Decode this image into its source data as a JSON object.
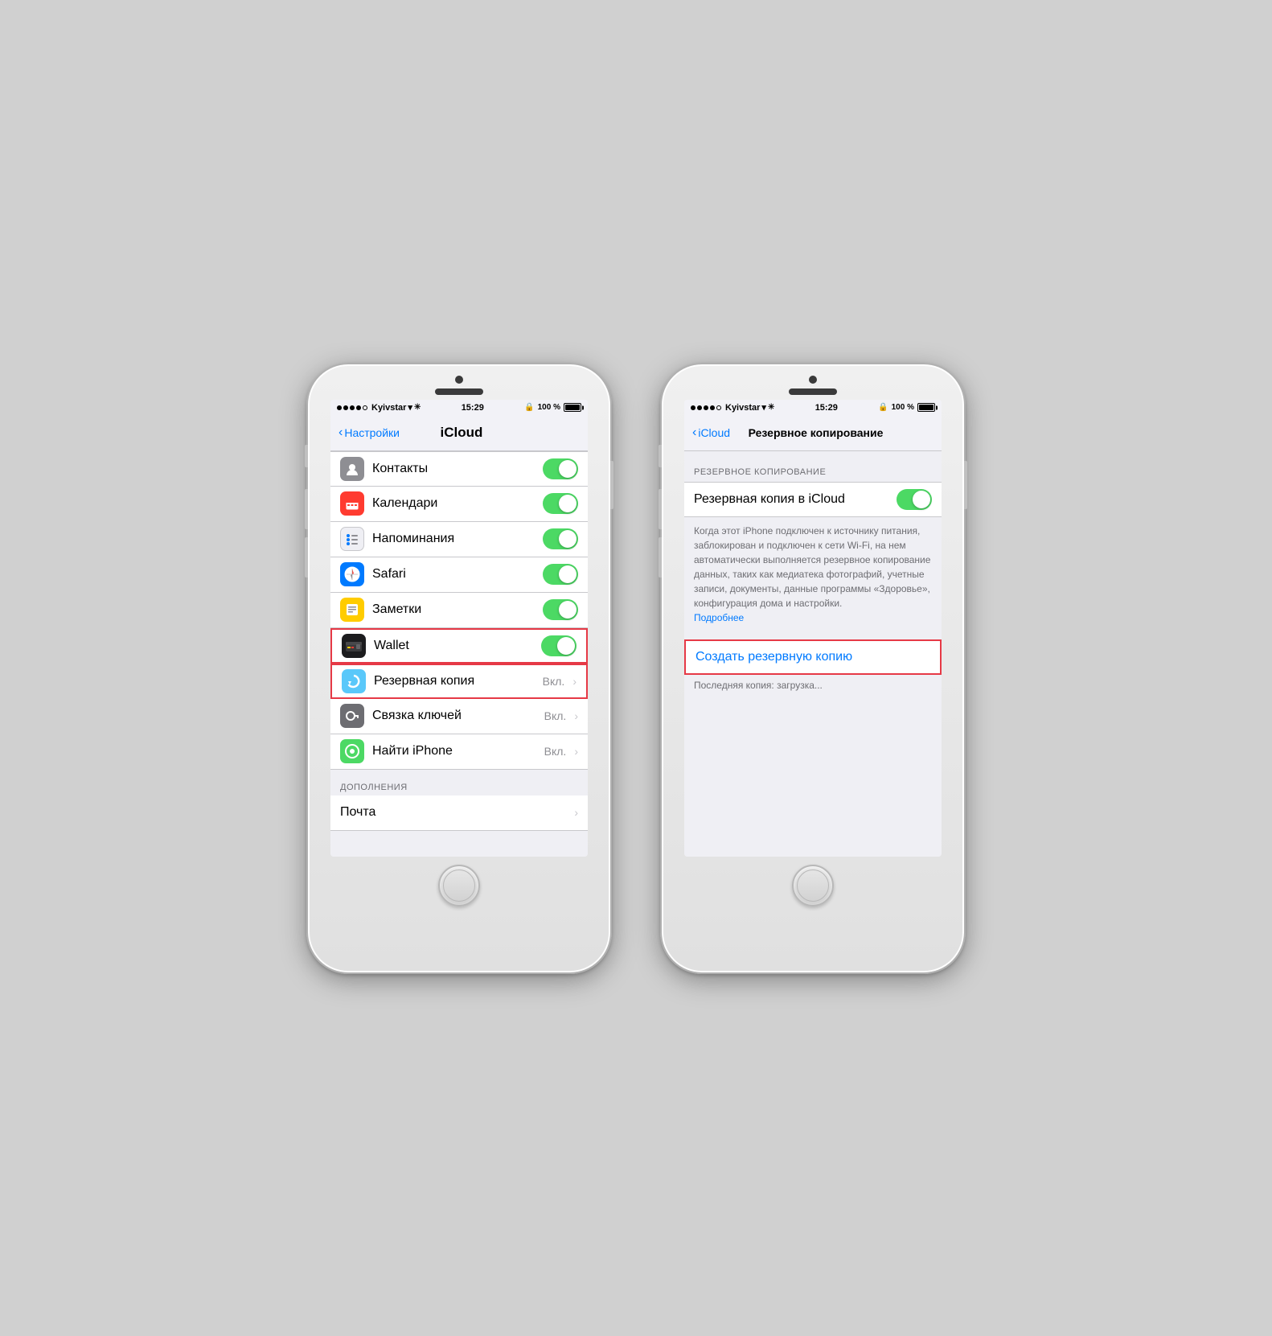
{
  "phone1": {
    "status": {
      "carrier": "Kyivstar",
      "time": "15:29",
      "battery": "100 %"
    },
    "nav": {
      "back_label": "Настройки",
      "title": "iCloud"
    },
    "items": [
      {
        "id": "contacts",
        "icon": "👤",
        "icon_color": "gray",
        "label": "Контакты",
        "toggle": true
      },
      {
        "id": "calendar",
        "icon": "📅",
        "icon_color": "red",
        "label": "Календари",
        "toggle": true
      },
      {
        "id": "reminders",
        "icon": "📋",
        "icon_color": "orange",
        "label": "Напоминания",
        "toggle": true
      },
      {
        "id": "safari",
        "icon": "🧭",
        "icon_color": "safari",
        "label": "Safari",
        "toggle": true
      },
      {
        "id": "notes",
        "icon": "📝",
        "icon_color": "yellow",
        "label": "Заметки",
        "toggle": true
      },
      {
        "id": "wallet",
        "icon": "💳",
        "icon_color": "wallet",
        "label": "Wallet",
        "toggle": true,
        "highlighted": true
      },
      {
        "id": "backup",
        "icon": "↺",
        "icon_color": "teal",
        "label": "Резервная копия",
        "value": "Вкл.",
        "chevron": true,
        "highlighted": true
      },
      {
        "id": "keychain",
        "icon": "🗝",
        "icon_color": "keychain",
        "label": "Связка ключей",
        "value": "Вкл.",
        "chevron": true
      },
      {
        "id": "findphone",
        "icon": "●",
        "icon_color": "findphone",
        "label": "Найти iPhone",
        "value": "Вкл.",
        "chevron": true
      }
    ],
    "section_header": "ДОПОЛНЕНИЯ",
    "extras": [
      {
        "id": "mail",
        "label": "Почта",
        "chevron": true
      }
    ]
  },
  "phone2": {
    "status": {
      "carrier": "Kyivstar",
      "time": "15:29",
      "battery": "100 %"
    },
    "nav": {
      "back_label": "iCloud",
      "title": "Резервное копирование"
    },
    "section_header": "РЕЗЕРВНОЕ КОПИРОВАНИЕ",
    "backup_toggle_label": "Резервная копия в iCloud",
    "description": "Когда этот iPhone подключен к источнику питания, заблокирован и подключен к сети Wi-Fi, на нем автоматически выполняется резервное копирование данных, таких как медиатека фотографий, учетные записи, документы, данные программы «Здоровье», конфигурация дома и настройки.",
    "more_link": "Подробнее",
    "create_backup_label": "Создать резервную копию",
    "last_copy": "Последняя копия: загрузка..."
  }
}
